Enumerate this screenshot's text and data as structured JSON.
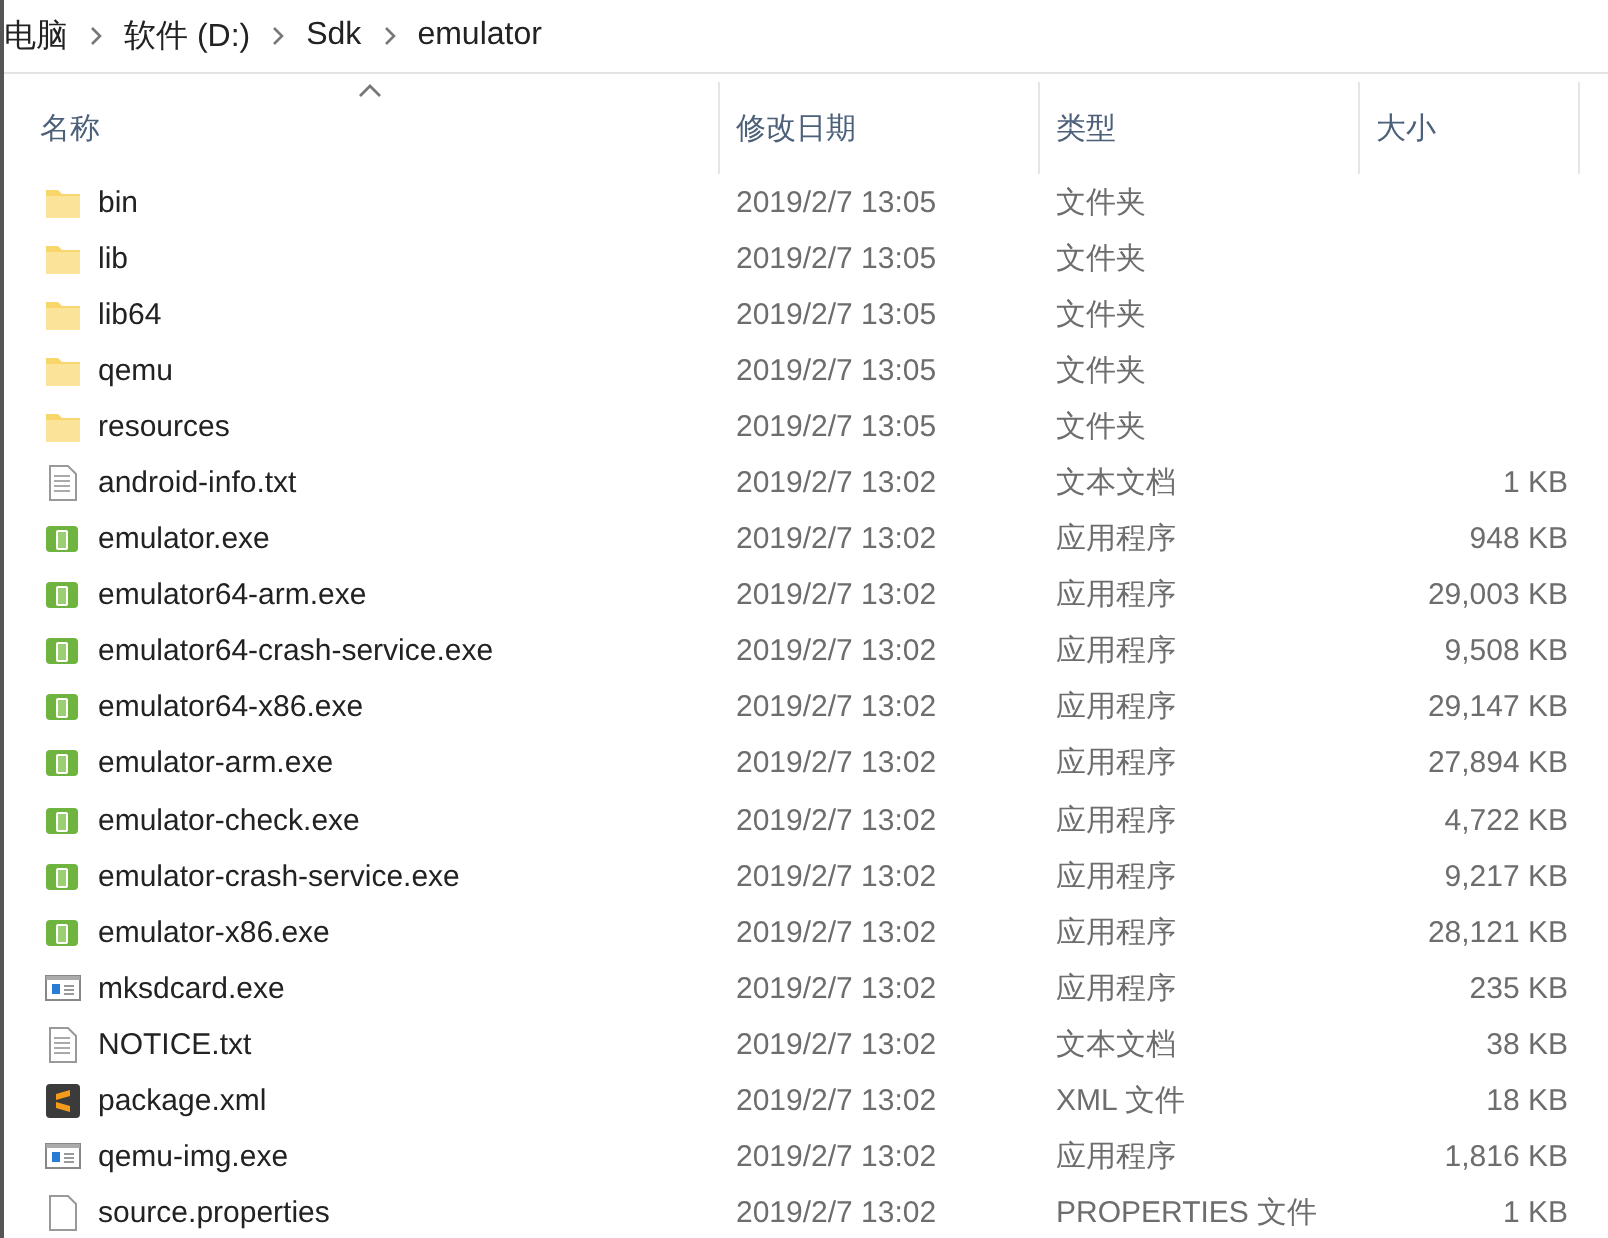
{
  "breadcrumb": [
    "电脑",
    "软件 (D:)",
    "Sdk",
    "emulator"
  ],
  "columns": [
    {
      "label": "名称",
      "sorted": true
    },
    {
      "label": "修改日期",
      "sorted": false
    },
    {
      "label": "类型",
      "sorted": false
    },
    {
      "label": "大小",
      "sorted": false
    }
  ],
  "files": [
    {
      "name": "bin",
      "kind": "folder",
      "modified": "2019/2/7 13:05",
      "type": "文件夹"
    },
    {
      "name": "lib",
      "kind": "folder",
      "modified": "2019/2/7 13:05",
      "type": "文件夹"
    },
    {
      "name": "lib64",
      "kind": "folder",
      "modified": "2019/2/7 13:05",
      "type": "文件夹"
    },
    {
      "name": "qemu",
      "kind": "folder",
      "modified": "2019/2/7 13:05",
      "type": "文件夹"
    },
    {
      "name": "resources",
      "kind": "folder",
      "modified": "2019/2/7 13:05",
      "type": "文件夹"
    },
    {
      "name": "android-info.txt",
      "kind": "text",
      "modified": "2019/2/7 13:02",
      "type": "文本文档",
      "size": "1 KB"
    },
    {
      "name": "emulator.exe",
      "kind": "app",
      "modified": "2019/2/7 13:02",
      "type": "应用程序",
      "size": "948 KB"
    },
    {
      "name": "emulator64-arm.exe",
      "kind": "app",
      "modified": "2019/2/7 13:02",
      "type": "应用程序",
      "size": "29,003 KB"
    },
    {
      "name": "emulator64-crash-service.exe",
      "kind": "app",
      "modified": "2019/2/7 13:02",
      "type": "应用程序",
      "size": "9,508 KB"
    },
    {
      "name": "emulator64-x86.exe",
      "kind": "app",
      "modified": "2019/2/7 13:02",
      "type": "应用程序",
      "size": "29,147 KB"
    },
    {
      "name": "emulator-arm.exe",
      "kind": "app",
      "modified": "2019/2/7 13:02",
      "type": "应用程序",
      "size": "27,894 KB"
    },
    {
      "name": "emulator-check.exe",
      "kind": "app",
      "modified": "2019/2/7 13:02",
      "type": "应用程序",
      "size": "4,722 KB"
    },
    {
      "name": "emulator-crash-service.exe",
      "kind": "app",
      "modified": "2019/2/7 13:02",
      "type": "应用程序",
      "size": "9,217 KB"
    },
    {
      "name": "emulator-x86.exe",
      "kind": "app",
      "modified": "2019/2/7 13:02",
      "type": "应用程序",
      "size": "28,121 KB"
    },
    {
      "name": "mksdcard.exe",
      "kind": "window",
      "modified": "2019/2/7 13:02",
      "type": "应用程序",
      "size": "235 KB"
    },
    {
      "name": "NOTICE.txt",
      "kind": "text",
      "modified": "2019/2/7 13:02",
      "type": "文本文档",
      "size": "38 KB"
    },
    {
      "name": "package.xml",
      "kind": "editor",
      "modified": "2019/2/7 13:02",
      "type": "XML 文件",
      "size": "18 KB"
    },
    {
      "name": "qemu-img.exe",
      "kind": "window",
      "modified": "2019/2/7 13:02",
      "type": "应用程序",
      "size": "1,816 KB"
    },
    {
      "name": "source.properties",
      "kind": "blank",
      "modified": "2019/2/7 13:02",
      "type": "PROPERTIES 文件",
      "size": "1 KB"
    }
  ]
}
